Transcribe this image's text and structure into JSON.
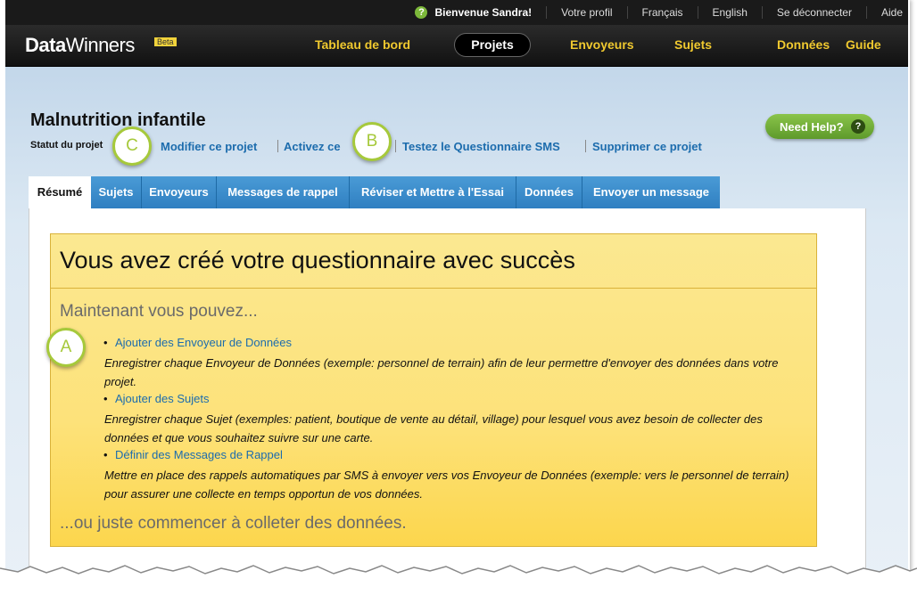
{
  "topbar": {
    "welcome": "Bienvenue Sandra!",
    "profile": "Votre profil",
    "lang_fr": "Français",
    "lang_en": "English",
    "logout": "Se déconnecter",
    "help": "Aide",
    "help_icon": "question-circle-icon"
  },
  "nav": {
    "logo_bold": "Data",
    "logo_rest": "Winners",
    "beta": "Beta",
    "dashboard": "Tableau de bord",
    "projects": "Projets",
    "senders": "Envoyeurs",
    "subjects": "Sujets",
    "data": "Données",
    "guide": "Guide"
  },
  "project": {
    "title": "Malnutrition infantile",
    "status_label": "Statut du projet",
    "edit": "Modifier ce projet",
    "activate": "Activez ce",
    "test_sms": "Testez le Questionnaire SMS",
    "delete": "Supprimer ce  projet",
    "need_help": "Need Help?",
    "need_help_icon": "?"
  },
  "callouts": {
    "a": "A",
    "b": "B",
    "c": "C"
  },
  "tabs": [
    "Résumé",
    "Sujets",
    "Envoyeurs",
    "Messages de rappel",
    "Réviser et Mettre à l'Essai",
    "Données",
    "Envoyer un message"
  ],
  "success": {
    "heading": "Vous avez créé votre questionnaire avec succès",
    "intro": "Maintenant vous pouvez...",
    "items": [
      {
        "link": "Ajouter des Envoyeur de Données",
        "desc": "Enregistrer chaque Envoyeur de Données (exemple: personnel de terrain) afin de leur permettre d'envoyer des données dans votre projet."
      },
      {
        "link": "Ajouter des Sujets",
        "desc": "Enregistrer chaque Sujet (exemples: patient, boutique de vente au détail, village) pour lesquel vous avez besoin de collecter des données et que vous souhaitez suivre sur une carte."
      },
      {
        "link": "Définir des Messages de Rappel",
        "desc": "Mettre en place des rappels automatiques par SMS à envoyer vers vos Envoyeur de Données (exemple: vers le personnel de terrain) pour assurer une collecte en temps opportun de vos données."
      }
    ],
    "outro": "...ou juste commencer à colleter des données."
  },
  "colors": {
    "accent_link": "#1c6cad",
    "nav_yellow": "#f0c92f",
    "tab_blue": "#2f7fc1",
    "callout_green": "#a6c93b"
  }
}
